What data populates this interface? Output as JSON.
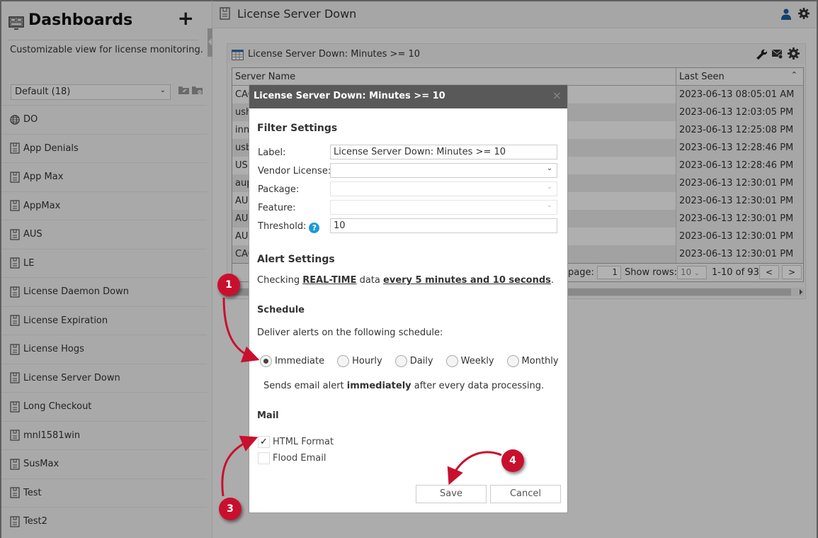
{
  "sidebar": {
    "title": "Dashboards",
    "add_label": "+",
    "description": "Customizable view for license monitoring.",
    "dashboard_select": "Default (18)",
    "items": [
      {
        "label": "DO",
        "icon": "globe-icon"
      },
      {
        "label": "App Denials",
        "icon": "report-icon"
      },
      {
        "label": "App Max",
        "icon": "report-icon"
      },
      {
        "label": "AppMax",
        "icon": "report-icon"
      },
      {
        "label": "AUS",
        "icon": "report-icon"
      },
      {
        "label": "LE",
        "icon": "report-icon"
      },
      {
        "label": "License Daemon Down",
        "icon": "report-icon"
      },
      {
        "label": "License Expiration",
        "icon": "report-icon"
      },
      {
        "label": "License Hogs",
        "icon": "report-icon"
      },
      {
        "label": "License Server Down",
        "icon": "report-icon"
      },
      {
        "label": "Long Checkout",
        "icon": "report-icon"
      },
      {
        "label": "mnl1581win",
        "icon": "report-icon"
      },
      {
        "label": "SusMax",
        "icon": "report-icon"
      },
      {
        "label": "Test",
        "icon": "report-icon"
      },
      {
        "label": "Test2",
        "icon": "report-icon"
      }
    ]
  },
  "header": {
    "title": "License Server Down"
  },
  "panel": {
    "title": "License Server Down: Minutes >= 10",
    "columns": [
      "Server Name",
      "Last Seen"
    ],
    "rows": [
      {
        "name": "CAC",
        "seen": "2023-06-13 08:05:01 AM"
      },
      {
        "name": "ush",
        "seen": "2023-06-13 12:03:05 PM"
      },
      {
        "name": "inn",
        "seen": "2023-06-13 12:25:08 PM"
      },
      {
        "name": "usb",
        "seen": "2023-06-13 12:28:46 PM"
      },
      {
        "name": "USE",
        "seen": "2023-06-13 12:28:46 PM"
      },
      {
        "name": "aup",
        "seen": "2023-06-13 12:30:01 PM"
      },
      {
        "name": "AUI",
        "seen": "2023-06-13 12:30:01 PM"
      },
      {
        "name": "AUI",
        "seen": "2023-06-13 12:30:01 PM"
      },
      {
        "name": "AUI",
        "seen": "2023-06-13 12:30:01 PM"
      },
      {
        "name": "CAC",
        "seen": "2023-06-13 12:30:01 PM"
      }
    ],
    "footer": {
      "page_label": "page:",
      "page_value": "1",
      "rows_label": "Show rows:",
      "rows_value": "10",
      "range": "1-10 of 93",
      "prev": "<",
      "next": ">"
    }
  },
  "modal": {
    "title": "License Server Down: Minutes >= 10",
    "close": "×",
    "filter_title": "Filter Settings",
    "fields": {
      "label_label": "Label:",
      "label_value": "License Server Down: Minutes >= 10",
      "vendor_label": "Vendor License:",
      "vendor_value": "",
      "package_label": "Package:",
      "package_value": "",
      "feature_label": "Feature:",
      "feature_value": "",
      "threshold_label": "Threshold:",
      "threshold_value": "10"
    },
    "alert_title": "Alert Settings",
    "checking_prefix": "Checking ",
    "checking_realtime": "REAL-TIME",
    "checking_mid": " data ",
    "checking_interval": "every 5 minutes and 10 seconds",
    "checking_suffix": ".",
    "schedule_title": "Schedule",
    "schedule_text": "Deliver alerts on the following schedule:",
    "schedule_options": [
      "Immediate",
      "Hourly",
      "Daily",
      "Weekly",
      "Monthly"
    ],
    "schedule_selected": "Immediate",
    "schedule_note_prefix": "Sends email alert ",
    "schedule_note_bold": "immediately",
    "schedule_note_suffix": " after every data processing.",
    "mail_title": "Mail",
    "html_format_label": "HTML Format",
    "html_format_checked": true,
    "flood_email_label": "Flood Email",
    "flood_email_checked": false,
    "save_label": "Save",
    "cancel_label": "Cancel"
  },
  "callouts": [
    "1",
    "3",
    "4"
  ],
  "colors": {
    "callout": "#c8102e",
    "modal_header": "#595959",
    "help_icon": "#1a9bd7",
    "user_icon": "#1a5fa0"
  }
}
